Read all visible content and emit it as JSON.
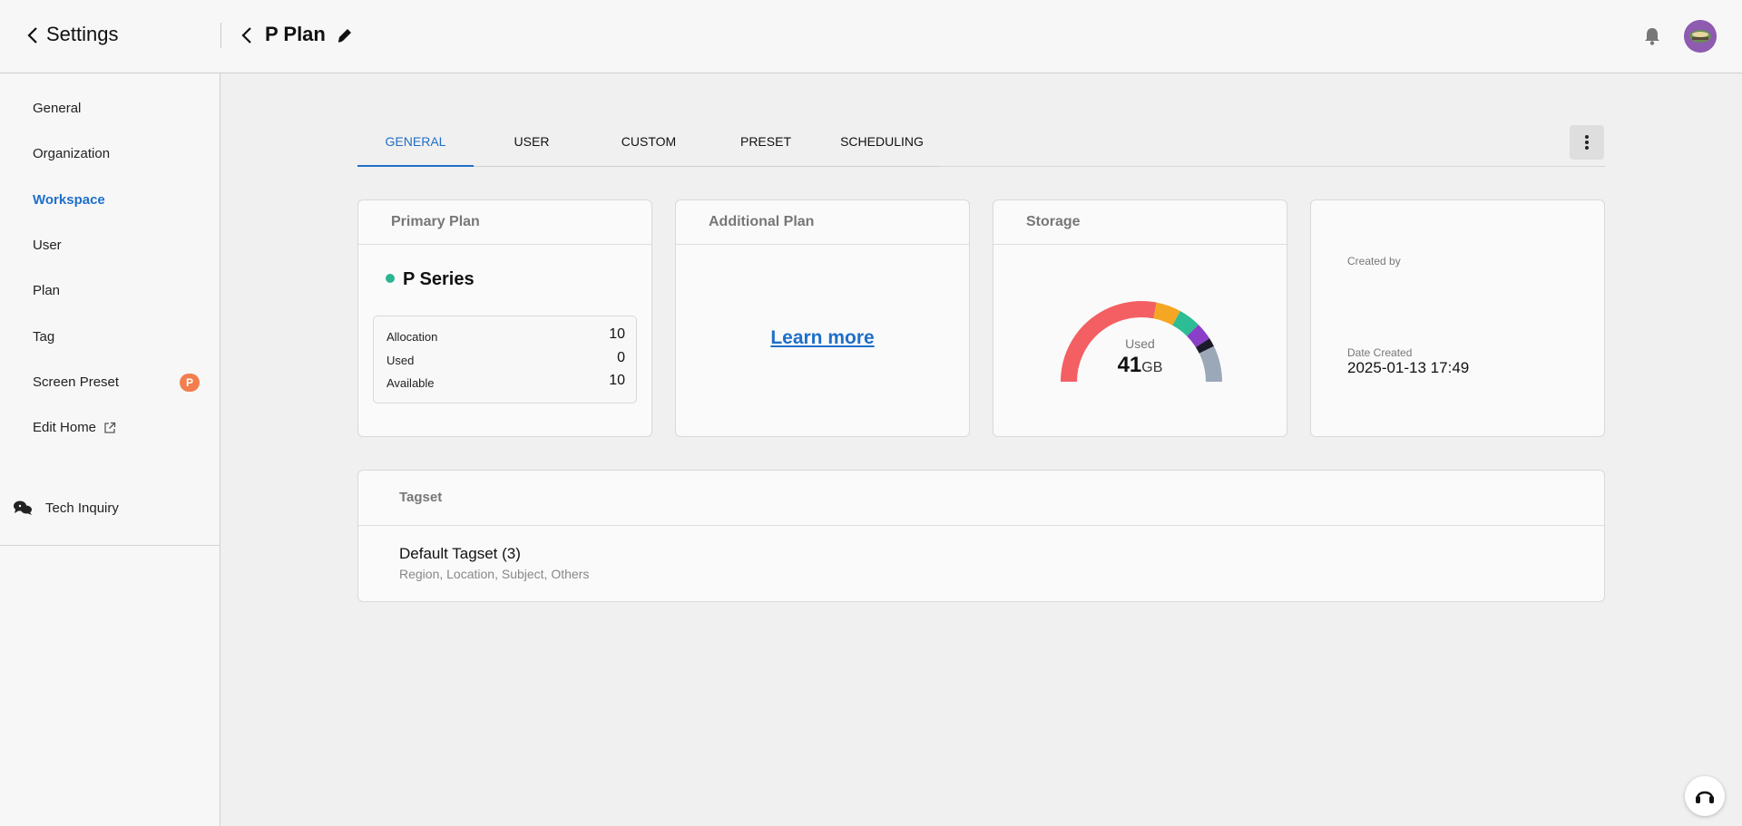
{
  "header": {
    "settings_label": "Settings",
    "page_title": "P Plan"
  },
  "sidebar": {
    "items": [
      {
        "label": "General"
      },
      {
        "label": "Organization"
      },
      {
        "label": "Workspace"
      },
      {
        "label": "User"
      },
      {
        "label": "Plan"
      },
      {
        "label": "Tag"
      },
      {
        "label": "Screen Preset",
        "badge": "P"
      },
      {
        "label": "Edit Home"
      }
    ],
    "tech_inquiry": "Tech Inquiry"
  },
  "tabs": [
    {
      "label": "GENERAL",
      "active": true
    },
    {
      "label": "USER"
    },
    {
      "label": "CUSTOM"
    },
    {
      "label": "PRESET"
    },
    {
      "label": "SCHEDULING"
    }
  ],
  "primary_plan": {
    "title": "Primary Plan",
    "series": "P Series",
    "rows": [
      {
        "label": "Allocation",
        "value": "10"
      },
      {
        "label": "Used",
        "value": "0"
      },
      {
        "label": "Available",
        "value": "10"
      }
    ]
  },
  "additional_plan": {
    "title": "Additional Plan",
    "link": "Learn more"
  },
  "storage": {
    "title": "Storage",
    "used_label": "Used",
    "used_value": "41",
    "unit": "GB",
    "segments": [
      {
        "color": "#f35f63",
        "fraction": 0.56
      },
      {
        "color": "#f5a623",
        "fraction": 0.1
      },
      {
        "color": "#2dbd94",
        "fraction": 0.09
      },
      {
        "color": "#8a3fc9",
        "fraction": 0.07
      },
      {
        "color": "#1a1a2a",
        "fraction": 0.035
      },
      {
        "color": "#9aa8b8",
        "fraction": 0.145
      }
    ]
  },
  "meta": {
    "created_by_label": "Created by",
    "date_created_label": "Date Created",
    "date_created_value": "2025-01-13 17:49"
  },
  "tagset": {
    "title": "Tagset",
    "name": "Default Tagset (3)",
    "description": "Region, Location, Subject, Others"
  },
  "colors": {
    "accent": "#1f6fc9",
    "status_dot": "#2bb592",
    "badge": "#f27e4e"
  }
}
